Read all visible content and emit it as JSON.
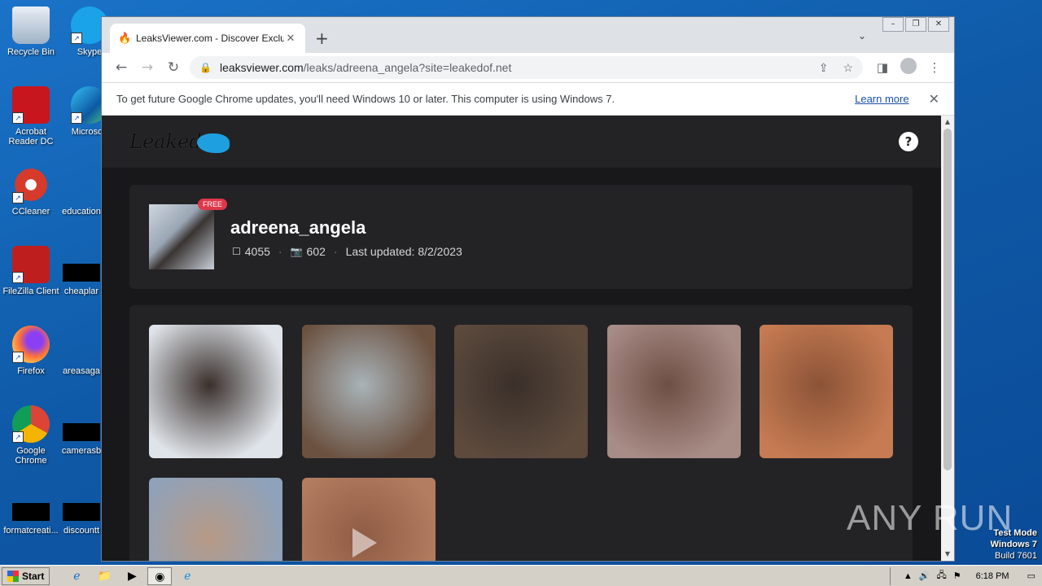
{
  "desktop": {
    "icons": [
      {
        "label": "Recycle Bin",
        "name": "recycle-bin-icon"
      },
      {
        "label": "Skype",
        "name": "skype-icon"
      },
      {
        "label": "Acrobat Reader DC",
        "name": "acrobat-icon"
      },
      {
        "label": "Microsoft",
        "name": "edge-icon"
      },
      {
        "label": "CCleaner",
        "name": "ccleaner-icon"
      },
      {
        "label": "education",
        "name": "file-icon"
      },
      {
        "label": "FileZilla Client",
        "name": "filezilla-icon"
      },
      {
        "label": "cheaplar",
        "name": "file-icon"
      },
      {
        "label": "Firefox",
        "name": "firefox-icon"
      },
      {
        "label": "areasaga",
        "name": "file-icon"
      },
      {
        "label": "Google Chrome",
        "name": "chrome-icon"
      },
      {
        "label": "camerasb",
        "name": "file-icon"
      },
      {
        "label": "formatcreati...",
        "name": "file-icon"
      },
      {
        "label": "discountt",
        "name": "file-icon"
      }
    ],
    "watermark": "ANY RUN",
    "test_mode": {
      "line1": "Test Mode",
      "line2": "Windows 7",
      "line3": "Build 7601"
    }
  },
  "browser": {
    "tab": {
      "title": "LeaksViewer.com - Discover Exclusiv",
      "close": "✕"
    },
    "new_tab": "+",
    "url": {
      "host": "leaksviewer.com",
      "path": "/leaks/adreena_angela?site=leakedof.net"
    },
    "infobar": {
      "message": "To get future Google Chrome updates, you'll need Windows 10 or later. This computer is using Windows 7.",
      "link": "Learn more"
    }
  },
  "site": {
    "logo_text": "Leaked",
    "help": "?",
    "profile": {
      "badge": "FREE",
      "username": "adreena_angela",
      "posts": "4055",
      "photos": "602",
      "updated": "Last updated: 8/2/2023"
    },
    "gallery": {
      "colors": [
        [
          "#dfe4ea",
          "#3a302c"
        ],
        [
          "#6b5140",
          "#a8b3b8"
        ],
        [
          "#5d4a3d",
          "#3a302a"
        ],
        [
          "#a88c86",
          "#6e4f45"
        ],
        [
          "#c67b52",
          "#8b5337"
        ],
        [
          "#8ea2bb",
          "#b79a86"
        ],
        [
          "#b27d60",
          "#8f5b44"
        ]
      ]
    }
  },
  "taskbar": {
    "start": "Start",
    "clock": "6:18 PM"
  }
}
